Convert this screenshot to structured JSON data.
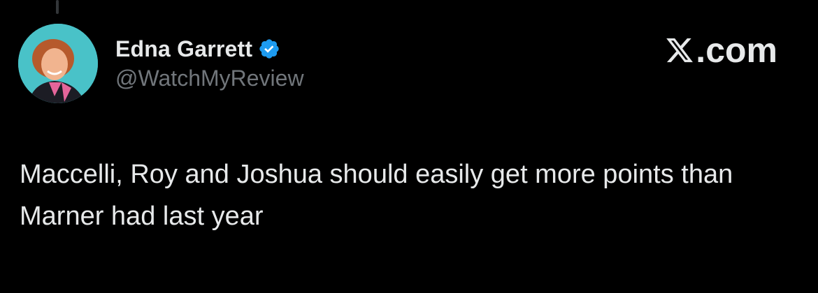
{
  "tweet": {
    "author": {
      "display_name": "Edna Garrett",
      "handle": "@WatchMyReview",
      "verified": true,
      "avatar_icon": "profile-photo"
    },
    "brand": {
      "icon": "x-logo-icon",
      "suffix": ".com"
    },
    "text": "Maccelli, Roy and Joshua should easily get more points than Marner had last year"
  },
  "colors": {
    "background": "#000000",
    "primary_text": "#e7e9ea",
    "secondary_text": "#71767b",
    "verified_badge": "#1d9bf0"
  }
}
